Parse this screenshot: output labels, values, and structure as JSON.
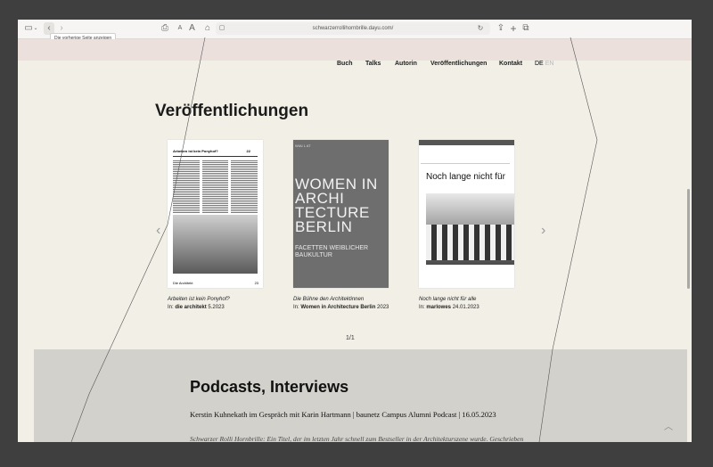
{
  "browser": {
    "url": "schwarzerrollihornbrille.dayu.com/",
    "tooltip": "Die vorherige Seite anzeigen",
    "reader_label": "A"
  },
  "nav": {
    "items": [
      "Buch",
      "Talks",
      "Autorin",
      "Veröffentlichungen",
      "Kontakt"
    ],
    "lang_de": "DE",
    "lang_en": "EN"
  },
  "publications": {
    "title": "Veröffentlichungen",
    "pager": "1/1",
    "items": [
      {
        "title": "Arbeiten ist kein Ponyhof?",
        "prefix": "In:",
        "source": "die architekt",
        "date": "5.2023"
      },
      {
        "title": "Die Bühne den Architektinnen",
        "prefix": "In:",
        "source": "Women in Architecture Berlin",
        "date": "2023"
      },
      {
        "title": "Noch lange nicht für alle",
        "prefix": "In:",
        "source": "marlowes",
        "date": "24.01.2023"
      }
    ],
    "cover1": {
      "heading": "Arbeiten ist kein Ponyhof?",
      "page": "22",
      "foot": "Die Architekt",
      "foot_page": "23"
    },
    "cover2": {
      "corner": "WIAI L AT",
      "text": [
        "WOMEN IN",
        "ARCHI",
        "TECTURE",
        "BERLIN"
      ],
      "sub": [
        "FACETTEN WEIBLICHER",
        "BAUKULTUR"
      ]
    },
    "cover3": {
      "heading": "Noch lange nicht für"
    }
  },
  "podcasts": {
    "title": "Podcasts, Interviews",
    "item_title": "Kerstin Kuhnekath im Gespräch mit Karin Hartmann | baunetz Campus Alumni Podcast | 16.05.2023",
    "item_desc": "Schwarzer Rolli Hornbrille: Ein Titel, der im letzten Jahr schnell zum Bestseller in der Architekturszene wurde. Geschrieben"
  }
}
